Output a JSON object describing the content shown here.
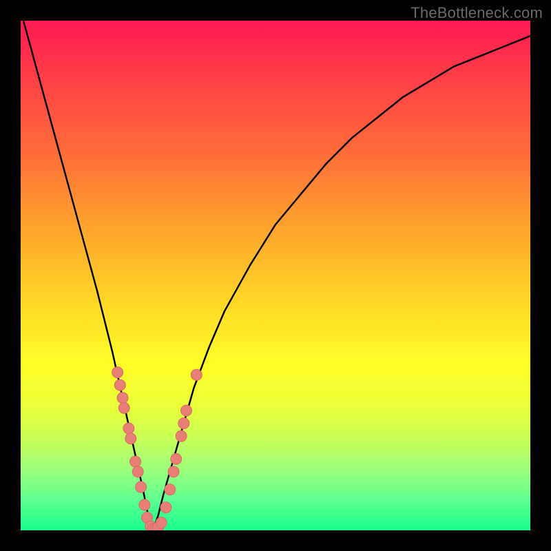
{
  "watermark": "TheBottleneck.com",
  "colors": {
    "frame": "#000000",
    "curve": "#000000",
    "dot_fill": "#e77f77",
    "dot_stroke": "#d86a63",
    "gradient_top": "#ff1a52",
    "gradient_bottom": "#18ff8a"
  },
  "chart_data": {
    "type": "line",
    "title": "",
    "xlabel": "",
    "ylabel": "",
    "xlim": [
      0,
      100
    ],
    "ylim": [
      0,
      100
    ],
    "legend": false,
    "grid": false,
    "notes": "V-shaped bottleneck curve on a red→green vertical heat gradient. Y is mismatch (0 at bottom = ideal). Minimum around x≈26. Pink dots mark sampled hardware near the optimum.",
    "series": [
      {
        "name": "bottleneck-curve",
        "x": [
          0,
          3,
          6,
          9,
          12,
          15,
          18,
          20,
          22,
          24,
          25,
          26,
          27,
          28,
          30,
          32,
          34,
          37,
          40,
          45,
          50,
          55,
          60,
          65,
          70,
          75,
          80,
          85,
          90,
          95,
          100
        ],
        "y": [
          102,
          91,
          80,
          69,
          58,
          47,
          35,
          26,
          17,
          8,
          3,
          0,
          3,
          7,
          14,
          21,
          28,
          36,
          43,
          52,
          60,
          66,
          72,
          77,
          81,
          85,
          88,
          91,
          93,
          95,
          97
        ]
      }
    ],
    "points": [
      {
        "name": "dot",
        "x": 19.0,
        "y": 31.0
      },
      {
        "name": "dot",
        "x": 19.5,
        "y": 28.5
      },
      {
        "name": "dot",
        "x": 20.0,
        "y": 26.0
      },
      {
        "name": "dot",
        "x": 20.3,
        "y": 24.0
      },
      {
        "name": "dot",
        "x": 21.2,
        "y": 20.0
      },
      {
        "name": "dot",
        "x": 21.6,
        "y": 18.0
      },
      {
        "name": "dot",
        "x": 22.5,
        "y": 13.5
      },
      {
        "name": "dot",
        "x": 23.0,
        "y": 11.5
      },
      {
        "name": "dot",
        "x": 23.6,
        "y": 8.5
      },
      {
        "name": "dot",
        "x": 24.3,
        "y": 5.0
      },
      {
        "name": "dot",
        "x": 24.8,
        "y": 2.5
      },
      {
        "name": "dot",
        "x": 25.5,
        "y": 0.8
      },
      {
        "name": "dot",
        "x": 26.0,
        "y": 0.3
      },
      {
        "name": "dot",
        "x": 26.5,
        "y": 0.3
      },
      {
        "name": "dot",
        "x": 27.0,
        "y": 0.6
      },
      {
        "name": "dot",
        "x": 27.6,
        "y": 1.5
      },
      {
        "name": "dot",
        "x": 28.5,
        "y": 4.5
      },
      {
        "name": "dot",
        "x": 29.3,
        "y": 8.0
      },
      {
        "name": "dot",
        "x": 30.0,
        "y": 11.5
      },
      {
        "name": "dot",
        "x": 30.5,
        "y": 14.0
      },
      {
        "name": "dot",
        "x": 31.5,
        "y": 18.5
      },
      {
        "name": "dot",
        "x": 32.0,
        "y": 21.0
      },
      {
        "name": "dot",
        "x": 32.5,
        "y": 23.5
      },
      {
        "name": "dot",
        "x": 34.5,
        "y": 30.5
      }
    ]
  }
}
